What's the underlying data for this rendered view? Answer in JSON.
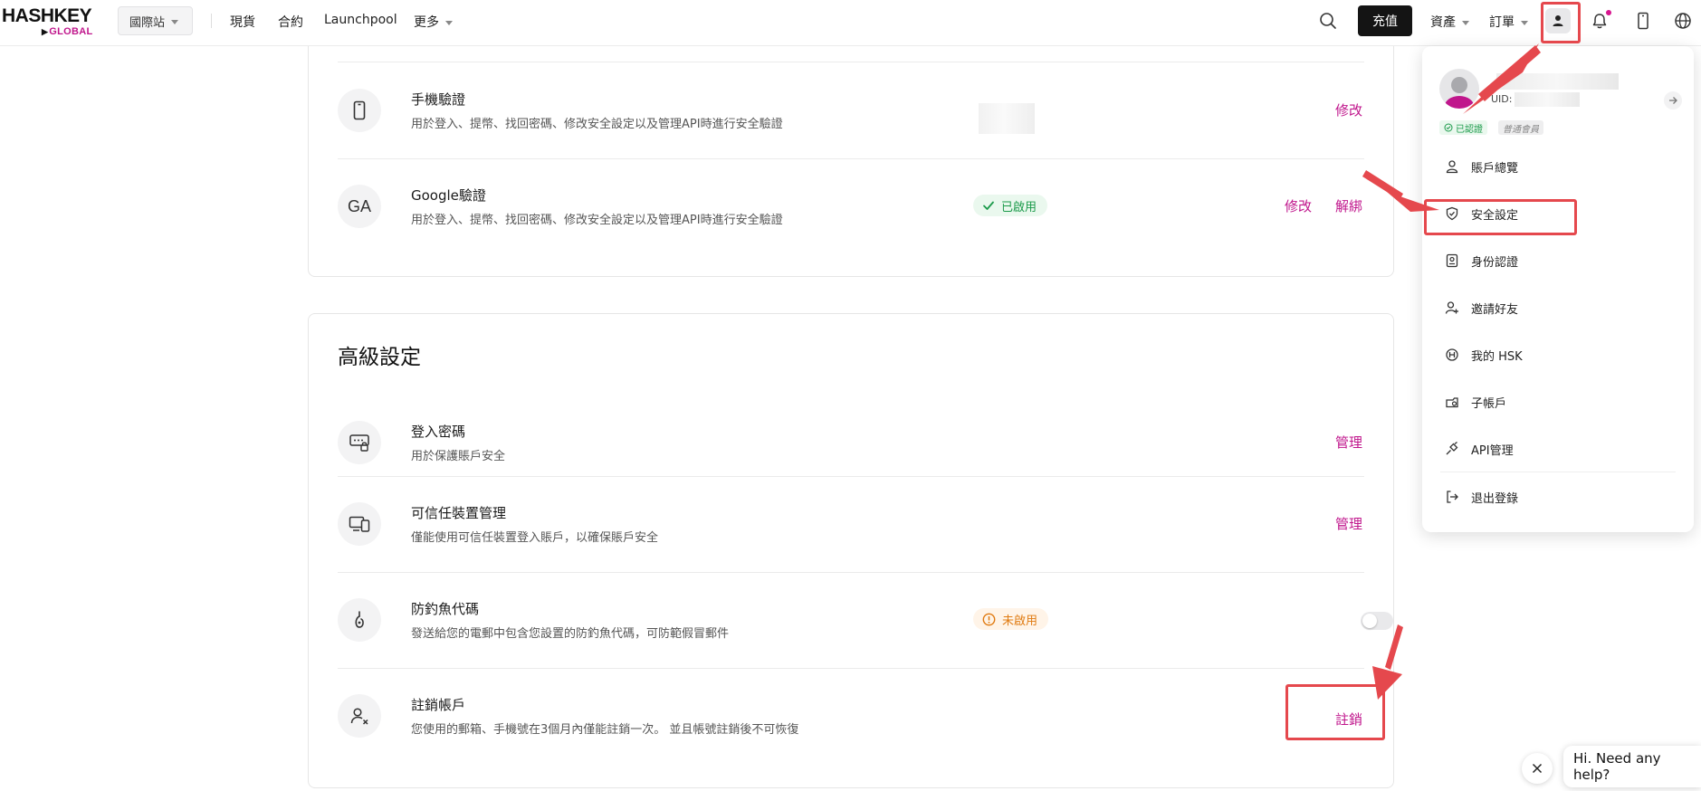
{
  "header": {
    "logo_top": "HASHKEY",
    "logo_bottom": "GLOBAL",
    "site_select": "國際站",
    "nav": [
      "現貨",
      "合約",
      "Launchpool",
      "更多"
    ],
    "recharge": "充值",
    "assets": "資產",
    "orders": "訂單"
  },
  "card1": {
    "rows": [
      {
        "title": "手機驗證",
        "desc": "用於登入、提幣、找回密碼、修改安全設定以及管理API時進行安全驗證",
        "action": "修改"
      },
      {
        "icon_text": "GA",
        "title": "Google驗證",
        "desc": "用於登入、提幣、找回密碼、修改安全設定以及管理API時進行安全驗證",
        "status": "已啟用",
        "action1": "修改",
        "action2": "解綁"
      }
    ]
  },
  "advanced": {
    "title": "高級設定",
    "rows": [
      {
        "title": "登入密碼",
        "desc": "用於保護賬戶安全",
        "action": "管理"
      },
      {
        "title": "可信任裝置管理",
        "desc": "僅能使用可信任裝置登入賬戶，以確保賬戶安全",
        "action": "管理"
      },
      {
        "title": "防釣魚代碼",
        "desc": "發送給您的電郵中包含您設置的防釣魚代碼，可防範假冒郵件",
        "status": "未啟用",
        "toggle_on": false
      },
      {
        "title": "註銷帳戶",
        "desc": "您使用的郵箱、手機號在3個月內僅能註銷一次。 並且帳號註銷後不可恢復",
        "action": "註銷"
      }
    ]
  },
  "dropdown": {
    "uid_label": "UID:",
    "badge_verified": "已認證",
    "badge_member": "普通會員",
    "items": [
      "賬戶總覽",
      "安全設定",
      "身份認證",
      "邀請好友",
      "我的 HSK",
      "子帳戶",
      "API管理",
      "退出登錄"
    ]
  },
  "chat": {
    "bubble": "Hi. Need any help?"
  },
  "colors": {
    "accent": "#c0168c",
    "annotation_red": "#e5484d",
    "success": "#1b9a4a",
    "warning": "#e07b12"
  }
}
